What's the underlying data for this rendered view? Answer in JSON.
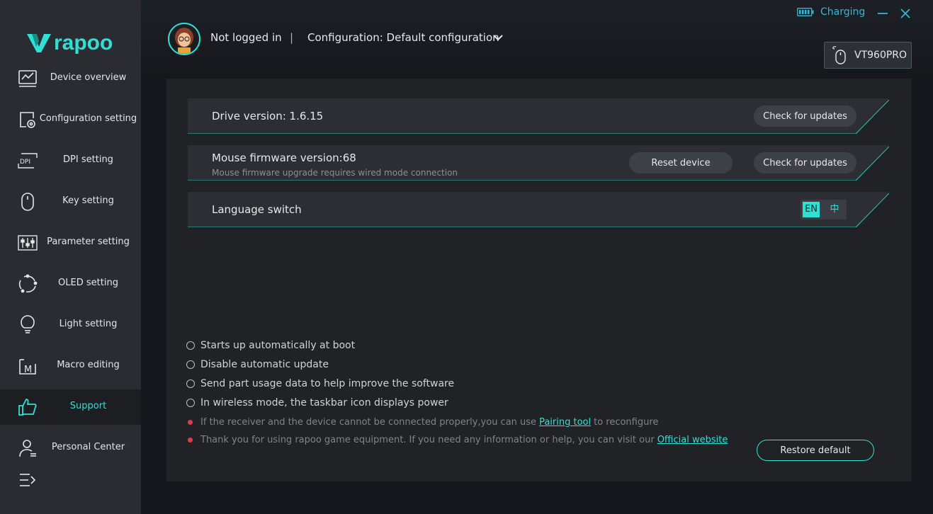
{
  "brand": {
    "name": "rapoo",
    "accent": "#2fe0d5"
  },
  "sidebar": {
    "items": [
      {
        "label": "Device overview",
        "icon": "chart-icon"
      },
      {
        "label": "Configuration setting",
        "icon": "config-icon"
      },
      {
        "label": "DPI setting",
        "icon": "dpi-icon"
      },
      {
        "label": "Key setting",
        "icon": "mouse-icon"
      },
      {
        "label": "Parameter setting",
        "icon": "sliders-icon"
      },
      {
        "label": "OLED setting",
        "icon": "oled-icon"
      },
      {
        "label": "Light setting",
        "icon": "bulb-icon"
      },
      {
        "label": "Macro editing",
        "icon": "macro-icon"
      },
      {
        "label": "Support",
        "icon": "thumbs-up-icon",
        "active": true
      },
      {
        "label": "Personal Center",
        "icon": "user-icon"
      }
    ]
  },
  "header": {
    "status": "Charging",
    "login": "Not logged in",
    "separator": "|",
    "configuration": "Configuration: Default configuration",
    "device": "VT960PRO"
  },
  "support": {
    "drive_version": "Drive version: 1.6.15",
    "firmware_version": "Mouse firmware version:68",
    "firmware_note": "Mouse firmware upgrade requires wired mode connection",
    "check_updates": "Check for updates",
    "reset_device": "Reset device",
    "language_switch": "Language switch",
    "lang_en": "EN",
    "lang_zh": "中",
    "options": [
      "Starts up automatically at boot",
      "Disable automatic update",
      "Send part usage data to help improve the software",
      "In wireless mode, the taskbar icon displays power"
    ],
    "note1_prefix": "If the receiver and the device cannot be connected properly,you can use",
    "note1_link": "Pairing tool",
    "note1_suffix": "to reconfigure",
    "note2_prefix": "Thank you for using rapoo game equipment. If you need any information or help, you can visit our",
    "note2_link": "Official website",
    "restore_default": "Restore default"
  }
}
